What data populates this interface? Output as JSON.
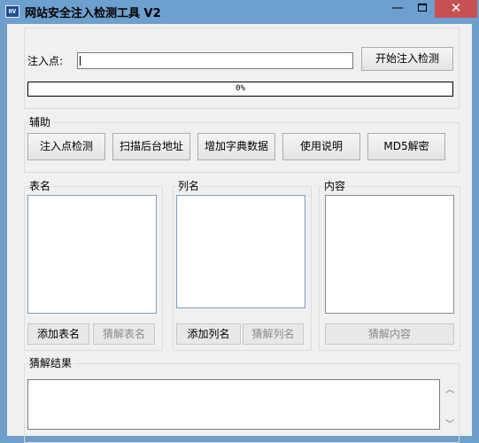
{
  "window": {
    "title": "网站安全注入检测工具 V2",
    "icon_text": "HV",
    "minimize_glyph": "—",
    "close_glyph": "✕"
  },
  "inject": {
    "label": "注入点:",
    "url_value": "",
    "start_button": "开始注入检测",
    "progress_percent": 0,
    "progress_text": "0%"
  },
  "assist": {
    "legend": "辅助",
    "buttons": [
      "注入点检测",
      "扫描后台地址",
      "增加字典数据",
      "使用说明",
      "MD5解密"
    ]
  },
  "tables": {
    "legend": "表名",
    "add_button": "添加表名",
    "guess_button": "猜解表名"
  },
  "columns": {
    "legend": "列名",
    "add_button": "添加列名",
    "guess_button": "猜解列名"
  },
  "content": {
    "legend": "内容",
    "guess_button": "猜解内容"
  },
  "result": {
    "legend": "猜解结果",
    "text": "",
    "scroll_up": "︿",
    "scroll_down": "﹀"
  },
  "colors": {
    "titlebar": "#6d9fcf",
    "close_button": "#c75050",
    "window_bg": "#f0f0f0",
    "progress_fill": "#06b025"
  }
}
